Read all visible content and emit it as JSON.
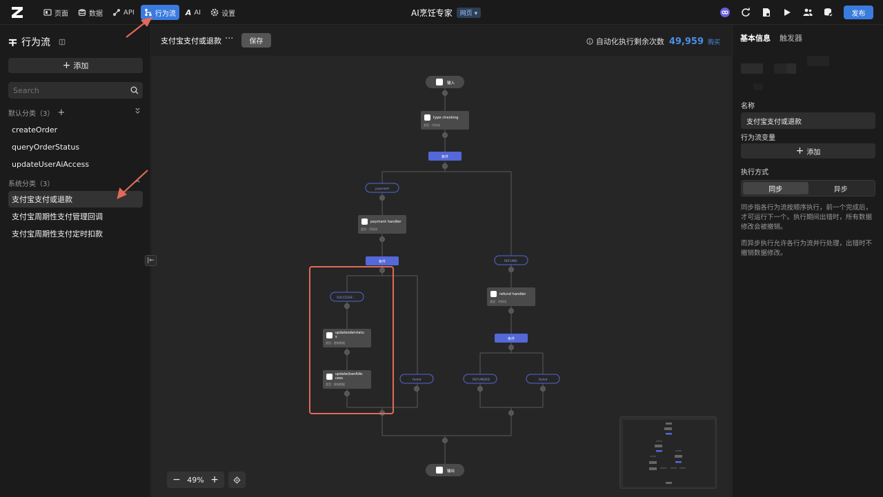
{
  "topbar": {
    "nav": [
      {
        "label": "页面",
        "icon": "page-icon"
      },
      {
        "label": "数据",
        "icon": "database-icon"
      },
      {
        "label": "API",
        "icon": "api-icon"
      },
      {
        "label": "行为流",
        "icon": "flow-icon",
        "active": true
      },
      {
        "label": "AI",
        "icon": "ai-icon"
      },
      {
        "label": "设置",
        "icon": "gear-icon"
      }
    ],
    "app_title": "AI烹饪专家",
    "app_type": "网页 ▾",
    "publish_label": "发布"
  },
  "sidebar": {
    "title": "行为流",
    "add_label": "添加",
    "search_placeholder": "Search",
    "default_category": "默认分类（3）",
    "default_items": [
      "createOrder",
      "queryOrderStatus",
      "updateUserAiAccess"
    ],
    "system_category": "系统分类（3）",
    "system_items": [
      "支付宝支付或退款",
      "支付宝周期性支付管理回调",
      "支付宝周期性支付定时扣款"
    ]
  },
  "canvas": {
    "flow_name": "支付宝支付或退款",
    "more": "···",
    "save_label": "保存",
    "quota_label": "自动化执行剩余次数",
    "quota_value": "49,959",
    "buy_label": "购买",
    "zoom_level": "49%",
    "nodes": {
      "input": "输入",
      "type_checking": "type checking",
      "type_checking_sub": "类型：代码块",
      "condition": "条件",
      "payment": "payment",
      "payment_handler": "payment handler",
      "payment_handler_sub": "类型：代码块",
      "refund": "REFUND",
      "refund_handler": "refund handler",
      "refund_handler_sub": "类型：代码块",
      "success": "SUCCESSF...",
      "failed": "failed",
      "refunded": "REFUNDED",
      "update_order_1": "updateoderstatu",
      "update_order_2": "s",
      "update_order_sub": "类型：更新数据",
      "update_ai_1": "updateUserAiAc",
      "update_ai_2": "cess",
      "update_ai_sub": "类型：更新数据",
      "output": "输出"
    }
  },
  "right_panel": {
    "tab_basic": "基本信息",
    "tab_trigger": "触发器",
    "name_label": "名称",
    "name_value": "支付宝支付或退款",
    "vars_label": "行为流变量",
    "vars_add": "添加",
    "mode_label": "执行方式",
    "mode_sync": "同步",
    "mode_async": "异步",
    "desc_sync": "同步指各行为流按顺序执行，前一个完成后，才可运行下一个。执行期间出错时，所有数据修改会被撤销。",
    "desc_async": "而异步执行允许各行为流并行处理，出错时不撤销数据修改。"
  },
  "colors": {
    "accent": "#3a7bde",
    "condition": "#5468d8",
    "highlight": "#e26a5a"
  }
}
